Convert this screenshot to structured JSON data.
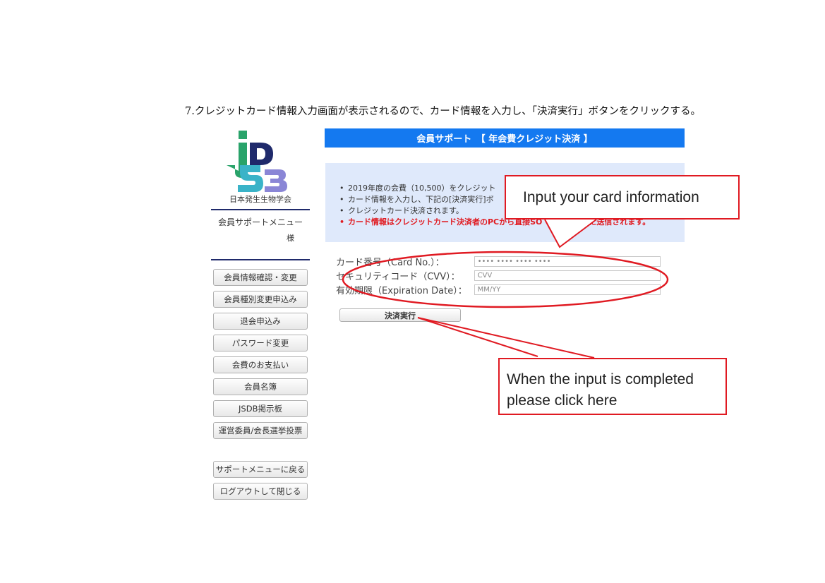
{
  "caption": "7.クレジットカード情報入力画面が表示されるので、カード情報を入力し、「決済実行」ボタンをクリックする。",
  "sidebar": {
    "logo_text": "JSDB",
    "org_name": "日本発生生物学会",
    "menu_title": "会員サポートメニュー",
    "honorific": "様",
    "items": [
      {
        "label": "会員情報確認・変更"
      },
      {
        "label": "会員種別変更申込み"
      },
      {
        "label": "退会申込み"
      },
      {
        "label": "パスワード変更"
      },
      {
        "label": "会費のお支払い"
      },
      {
        "label": "会員名簿"
      },
      {
        "label": "JSDB掲示板"
      },
      {
        "label": "運営委員/会長選挙投票"
      }
    ],
    "bottom_items": [
      {
        "label": "サポートメニューに戻る"
      },
      {
        "label": "ログアウトして閉じる"
      }
    ]
  },
  "header": {
    "title": "会員サポート　【 年会費クレジット決済 】"
  },
  "info": {
    "bullets": [
      "2019年度の会費（10,500）をクレジット",
      "カード情報を入力し、下記の[決済実行]ボ",
      "クレジットカード決済されます。",
      "カード情報はクレジットカード決済者のPCから直接SO　　　　　　に送信されます。"
    ]
  },
  "form": {
    "card_label": "カード番号（Card No.）：",
    "card_placeholder": "•••• •••• •••• ••••",
    "cvv_label": "セキュリティコード（CVV）：",
    "cvv_placeholder": "CVV",
    "exp_label": "有効期限（Expiration Date）：",
    "exp_placeholder": "MM/YY",
    "submit_label": "決済実行"
  },
  "annotations": {
    "callout1": "Input your card information",
    "callout2_line1": "When the input is completed",
    "callout2_line2": "please click here",
    "color": "#e01a22"
  },
  "colors": {
    "header_blue": "#1479f0",
    "info_bg": "#dfe9fb",
    "navy_rule": "#1f2a6b",
    "logo_navy": "#1f2a6b",
    "logo_green": "#29a36a",
    "logo_teal": "#3ab3c8",
    "logo_violet": "#8a86d6"
  }
}
